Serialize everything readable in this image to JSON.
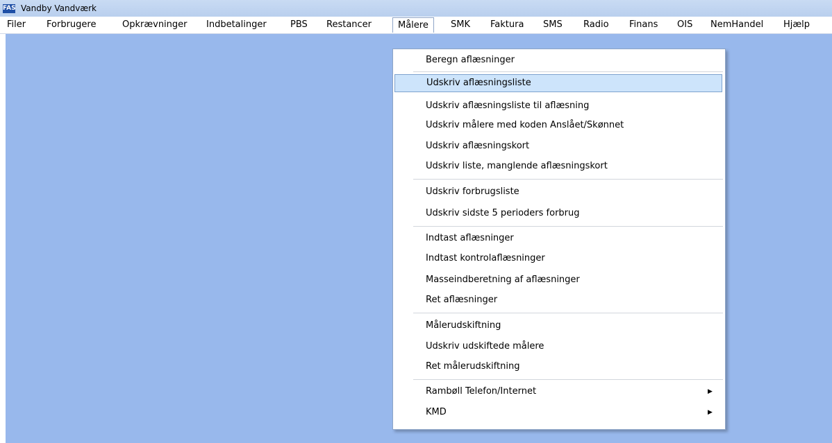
{
  "window": {
    "icon_text": "FAS",
    "title": "Vandby Vandværk"
  },
  "menubar": [
    "Filer",
    "Forbrugere",
    "Opkrævninger",
    "Indbetalinger",
    "PBS",
    "Restancer",
    "Målere",
    "SMK",
    "Faktura",
    "SMS",
    "Radio",
    "Finans",
    "OIS",
    "NemHandel",
    "Hjælp"
  ],
  "active_menu": "Målere",
  "dropdown": {
    "highlighted": "Udskriv aflæsningsliste",
    "items": [
      "Beregn aflæsninger",
      "Udskriv aflæsningsliste",
      "Udskriv aflæsningsliste til aflæsning",
      "Udskriv målere med koden Anslået/Skønnet",
      "Udskriv aflæsningskort",
      "Udskriv liste, manglende aflæsningskort",
      "Udskriv forbrugsliste",
      "Udskriv sidste 5 perioders forbrug",
      "Indtast aflæsninger",
      "Indtast kontrolaflæsninger",
      "Masseindberetning af aflæsninger",
      "Ret aflæsninger",
      "Målerudskiftning",
      "Udskriv udskiftede målere",
      "Ret målerudskiftning",
      "Rambøll Telefon/Internet",
      "KMD"
    ],
    "submenu_arrow": "▶"
  }
}
